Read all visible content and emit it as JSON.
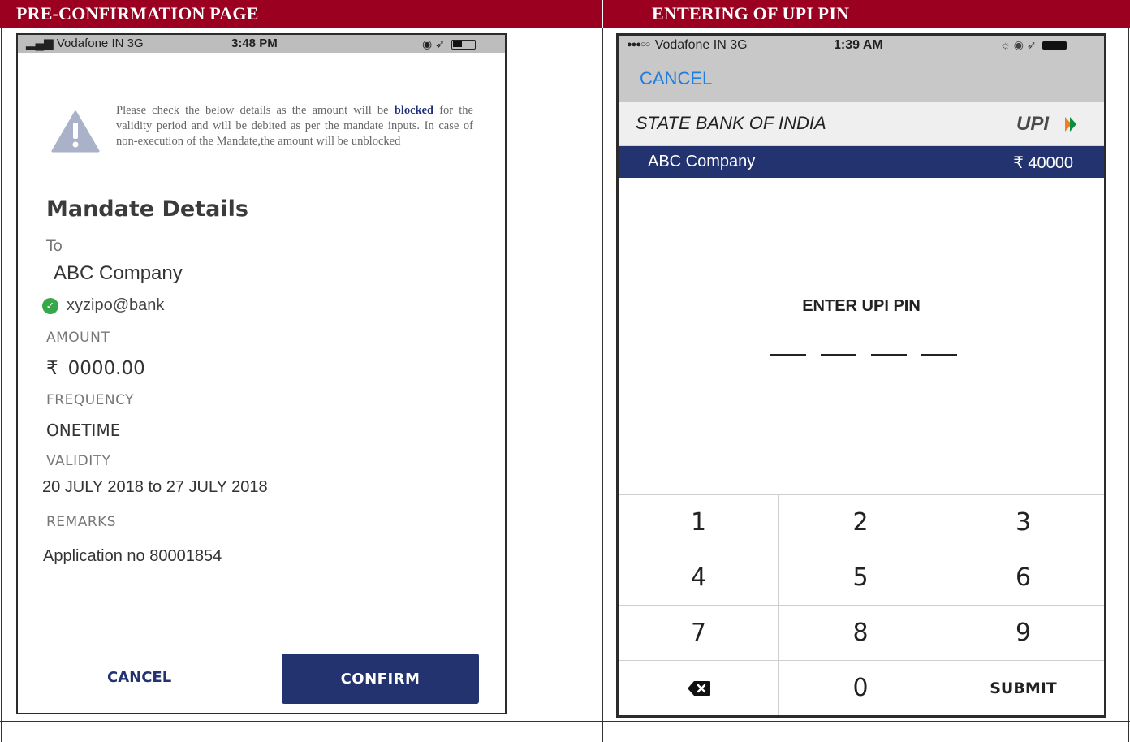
{
  "headers": {
    "left": "PRE-CONFIRMATION PAGE",
    "right": "ENTERING OF UPI PIN"
  },
  "pre_confirmation": {
    "status_bar": {
      "carrier": "Vodafone IN  3G",
      "time": "3:48 PM"
    },
    "notice": {
      "before": "Please check the below details as the amount will be ",
      "bold": "blocked",
      "after": " for the validity period and will be debited as per the mandate inputs. In case of non-execution of the Mandate,the amount will be unblocked"
    },
    "title": "Mandate Details",
    "to_label": "To",
    "payee_name": "ABC Company",
    "payee_vpa": "xyzipo@bank",
    "amount_label": "AMOUNT",
    "currency_symbol": "₹",
    "amount_value": "0000.00",
    "frequency_label": "FREQUENCY",
    "frequency_value": "ONETIME",
    "validity_label": "VALIDITY",
    "validity_value": "20 JULY 2018 to 27 JULY 2018",
    "remarks_label": "REMARKS",
    "remarks_value": "Application no 80001854",
    "cancel_label": "CANCEL",
    "confirm_label": "CONFIRM",
    "icons": {
      "warning": "warning-triangle-icon",
      "verified": "check-circle-icon"
    },
    "colors": {
      "primary": "#23336f",
      "verified": "#35a84a"
    }
  },
  "upi_pin": {
    "status_bar": {
      "carrier": "Vodafone IN  3G",
      "time": "1:39 AM"
    },
    "cancel_label": "CANCEL",
    "bank_name": "STATE BANK OF INDIA",
    "logo_text": "UPI",
    "payee_name": "ABC Company",
    "amount": "₹ 40000",
    "prompt": "ENTER UPI PIN",
    "pin_length": 4,
    "keypad": [
      "1",
      "2",
      "3",
      "4",
      "5",
      "6",
      "7",
      "8",
      "9",
      "",
      "0",
      "SUBMIT"
    ],
    "icons": {
      "backspace": "backspace-icon"
    },
    "colors": {
      "header_bar": "#23336f",
      "cancel_link": "#1f7ce0"
    }
  },
  "colors": {
    "header_background": "#9b0020"
  }
}
